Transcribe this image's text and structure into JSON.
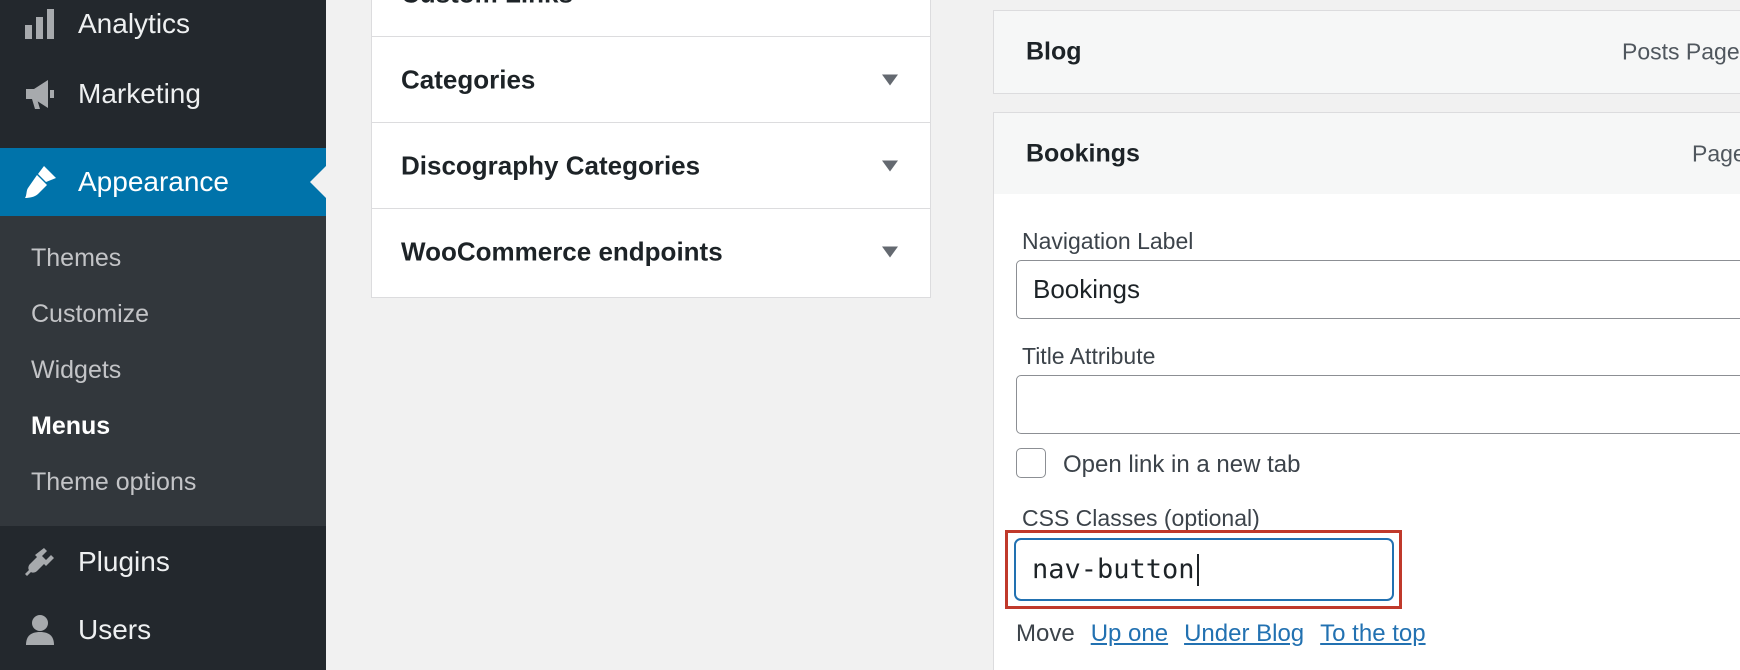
{
  "sidebar": {
    "top_items": [
      {
        "label": "Analytics",
        "icon": "bar-chart-icon"
      },
      {
        "label": "Marketing",
        "icon": "megaphone-icon"
      },
      {
        "label": "Appearance",
        "icon": "paintbrush-icon",
        "active": true
      },
      {
        "label": "Plugins",
        "icon": "plug-icon"
      },
      {
        "label": "Users",
        "icon": "user-icon"
      }
    ],
    "submenu": [
      {
        "label": "Themes"
      },
      {
        "label": "Customize"
      },
      {
        "label": "Widgets"
      },
      {
        "label": "Menus",
        "current": true
      },
      {
        "label": "Theme options"
      }
    ]
  },
  "add_items": {
    "sections": [
      {
        "title": "Custom Links"
      },
      {
        "title": "Categories"
      },
      {
        "title": "Discography Categories"
      },
      {
        "title": "WooCommerce endpoints"
      }
    ]
  },
  "menu_structure": {
    "items": [
      {
        "title": "Blog",
        "type": "Posts Page"
      },
      {
        "title": "Bookings",
        "type": "Page"
      }
    ],
    "settings": {
      "nav_label_label": "Navigation Label",
      "nav_label_value": "Bookings",
      "title_attr_label": "Title Attribute",
      "title_attr_value": "",
      "new_tab_label": "Open link in a new tab",
      "css_classes_label": "CSS Classes (optional)",
      "css_classes_value": "nav-button",
      "move_label": "Move",
      "move_links": [
        "Up one",
        "Under Blog",
        "To the top"
      ]
    }
  },
  "colors": {
    "sidebar_bg": "#23282d",
    "submenu_bg": "#32373c",
    "accent": "#0073aa",
    "link": "#2271b1",
    "highlight": "#c0392b"
  }
}
